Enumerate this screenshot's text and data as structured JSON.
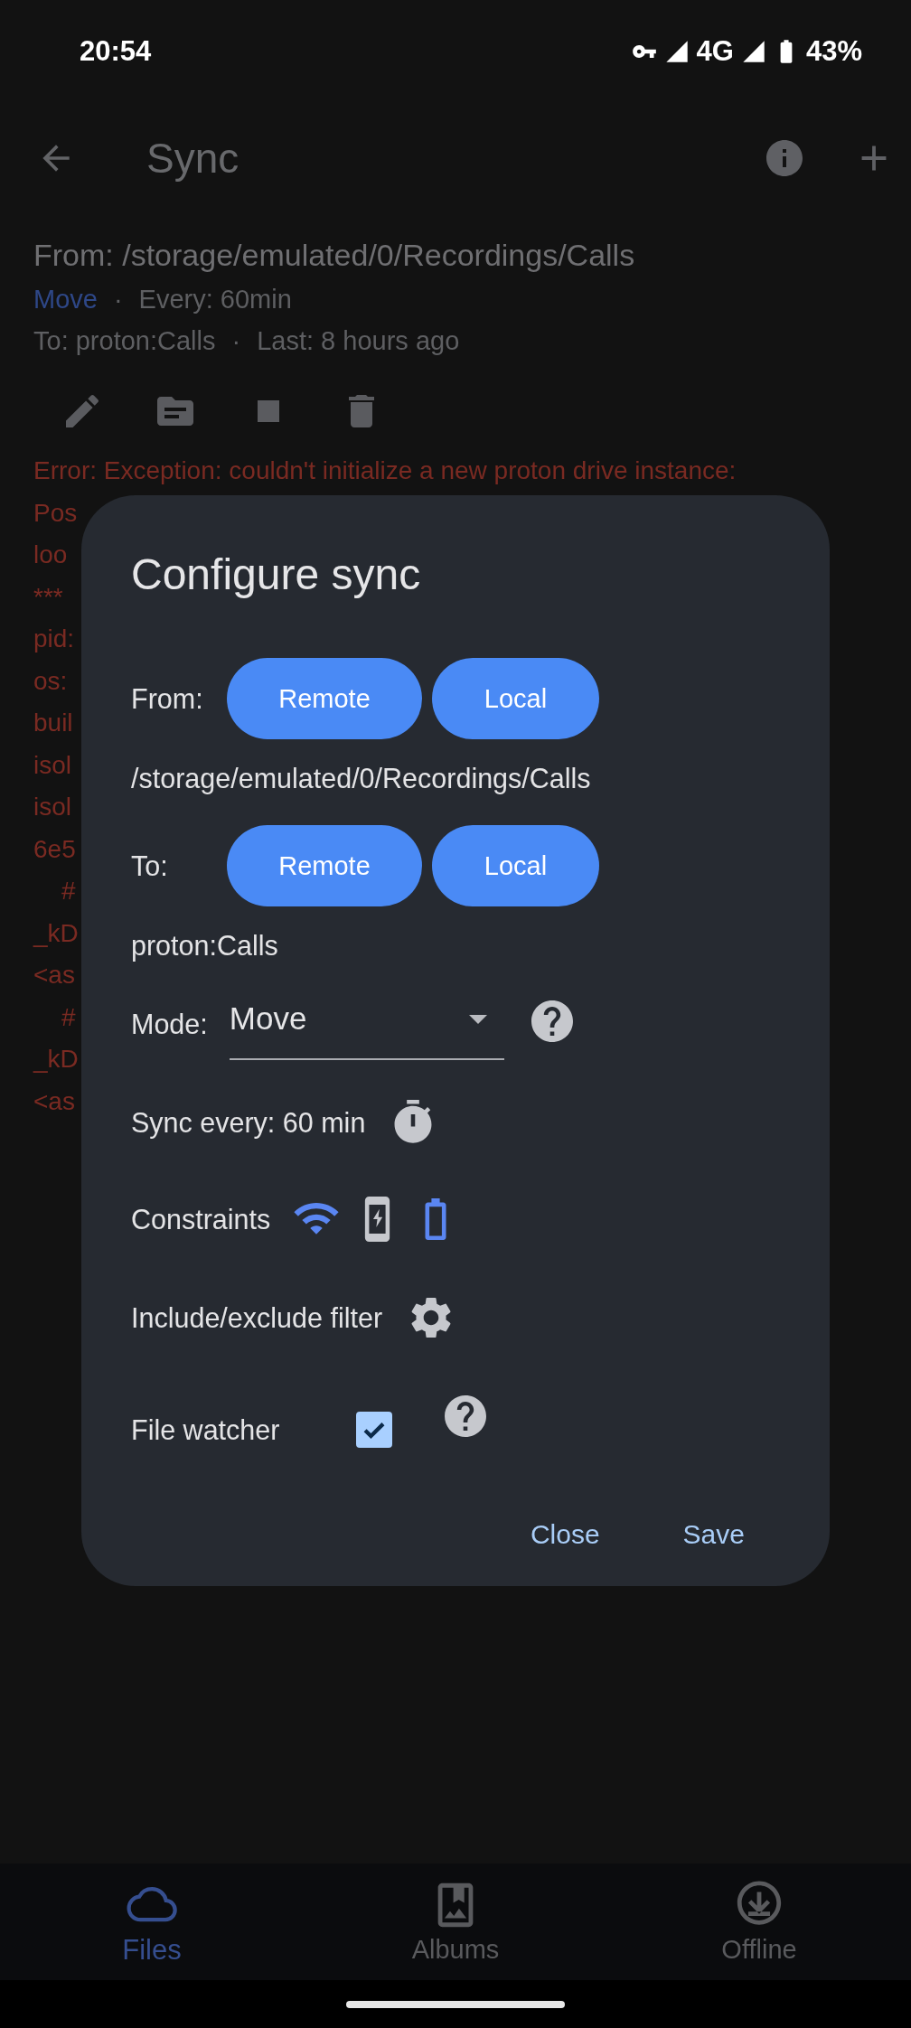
{
  "status_bar": {
    "time": "20:54",
    "network": "4G",
    "battery": "43%"
  },
  "app_bar": {
    "title": "Sync"
  },
  "sync_item": {
    "from": "From: /storage/emulated/0/Recordings/Calls",
    "mode": "Move",
    "separator_1": "·",
    "interval": "Every: 60min",
    "to": "To: proton:Calls",
    "separator_2": "·",
    "last": "Last: 8 hours ago"
  },
  "error_lines": [
    "Error: Exception: couldn't initialize a new proton drive instance:",
    "Pos",
    "loo",
    "***",
    "pid:",
    "os:",
    "buil",
    "isol",
    "isol",
    "6e5",
    "    #",
    "_kD",
    "<as",
    "    #",
    "_kD",
    "<as"
  ],
  "dialog": {
    "title": "Configure sync",
    "from": {
      "label": "From:",
      "buttons": [
        "Remote",
        "Local"
      ],
      "path": "/storage/emulated/0/Recordings/Calls"
    },
    "to": {
      "label": "To:",
      "buttons": [
        "Remote",
        "Local"
      ],
      "path": "proton:Calls"
    },
    "mode": {
      "label": "Mode:",
      "value": "Move"
    },
    "sync_every": {
      "label": "Sync every: 60 min"
    },
    "constraints": {
      "label": "Constraints",
      "items": [
        {
          "kind": "wifi",
          "on": true
        },
        {
          "kind": "charging",
          "on": false
        },
        {
          "kind": "battery",
          "on": true
        }
      ]
    },
    "filter": {
      "label": "Include/exclude filter"
    },
    "file_watcher": {
      "label": "File watcher",
      "checked": true
    },
    "actions": [
      "Close",
      "Save"
    ]
  },
  "bottom_nav": [
    {
      "label": "Files",
      "kind": "files",
      "selected": true
    },
    {
      "label": "Albums",
      "kind": "albums",
      "selected": false
    },
    {
      "label": "Offline",
      "kind": "offline",
      "selected": false
    }
  ]
}
